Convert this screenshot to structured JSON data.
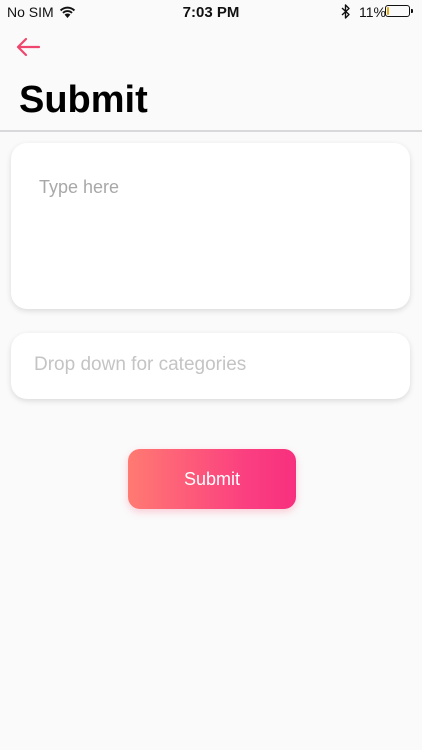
{
  "status_bar": {
    "carrier": "No SIM",
    "time": "7:03 PM",
    "battery_percent": "11%",
    "battery_level": 0.11,
    "battery_color": "#e4a91a",
    "icons": [
      "wifi-icon",
      "bluetooth-icon",
      "battery-icon"
    ]
  },
  "nav": {
    "back_icon": "arrow-left-icon",
    "accent_color": "#f0466e"
  },
  "header": {
    "title": "Submit"
  },
  "form": {
    "text_input": {
      "placeholder": "Type here",
      "value": ""
    },
    "category_dropdown": {
      "placeholder": "Drop down for categories"
    },
    "submit_label": "Submit"
  },
  "colors": {
    "background": "#fafafa",
    "button_gradient_start": "#ff7a72",
    "button_gradient_end": "#f7307e"
  }
}
